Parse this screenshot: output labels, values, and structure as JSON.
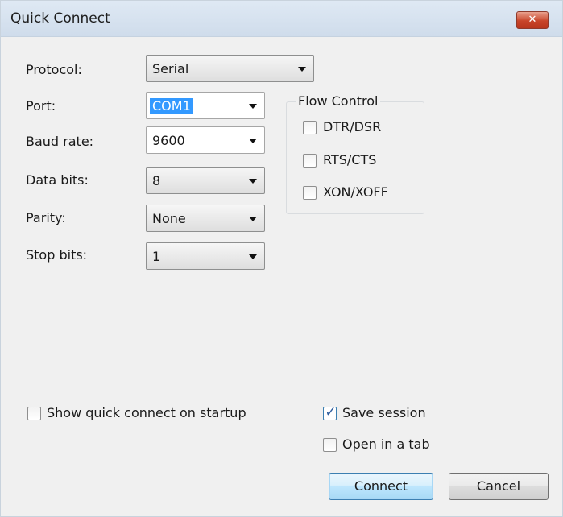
{
  "window": {
    "title": "Quick Connect",
    "close_glyph": "✕"
  },
  "fields": {
    "protocol": {
      "label": "Protocol:",
      "value": "Serial"
    },
    "port": {
      "label": "Port:",
      "value": "COM1"
    },
    "baud_rate": {
      "label": "Baud rate:",
      "value": "9600"
    },
    "data_bits": {
      "label": "Data bits:",
      "value": "8"
    },
    "parity": {
      "label": "Parity:",
      "value": "None"
    },
    "stop_bits": {
      "label": "Stop bits:",
      "value": "1"
    }
  },
  "flow_control": {
    "title": "Flow Control",
    "options": [
      {
        "label": "DTR/DSR",
        "checked": false
      },
      {
        "label": "RTS/CTS",
        "checked": false
      },
      {
        "label": "XON/XOFF",
        "checked": false
      }
    ]
  },
  "options": {
    "show_on_startup": {
      "label": "Show quick connect on startup",
      "checked": false
    },
    "save_session": {
      "label": "Save session",
      "checked": true
    },
    "open_in_tab": {
      "label": "Open in a tab",
      "checked": false
    }
  },
  "buttons": {
    "connect": "Connect",
    "cancel": "Cancel"
  },
  "icons": {
    "dropdown": "chevron-down-icon",
    "check": "checkmark-icon",
    "close": "close-icon"
  },
  "colors": {
    "titlebar": "#cfdceb",
    "close_button": "#c8452a",
    "selection": "#3399ff",
    "default_button": "#bee6fd"
  }
}
